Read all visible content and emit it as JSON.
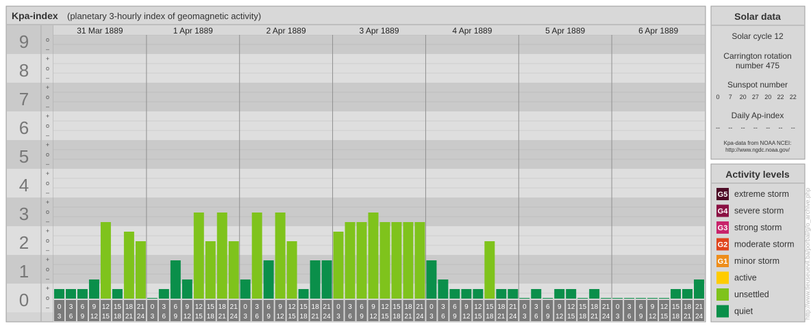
{
  "header": {
    "title": "Kpa-index",
    "subtitle": "(planetary 3-hourly index of geomagnetic activity)"
  },
  "chart_data": {
    "type": "bar",
    "ylim": [
      0,
      9
    ],
    "y_major_labels": [
      "0",
      "1",
      "2",
      "3",
      "4",
      "5",
      "6",
      "7",
      "8",
      "9"
    ],
    "minor_marks": [
      "–",
      "o",
      "+"
    ],
    "days": [
      "31 Mar 1889",
      "1 Apr 1889",
      "2 Apr 1889",
      "3 Apr 1889",
      "4 Apr 1889",
      "5 Apr 1889",
      "6 Apr 1889"
    ],
    "hour_labels_top": [
      "0",
      "3",
      "6",
      "9",
      "12",
      "15",
      "18",
      "21"
    ],
    "hour_labels_bottom": [
      "3",
      "6",
      "9",
      "12",
      "15",
      "18",
      "21",
      "24"
    ],
    "values": [
      [
        0.333,
        0.333,
        0.333,
        0.667,
        2.667,
        0.333,
        2.333,
        2.0
      ],
      [
        0.0,
        0.333,
        1.333,
        0.667,
        3.0,
        2.0,
        3.0,
        2.0
      ],
      [
        0.667,
        3.0,
        1.333,
        3.0,
        2.0,
        0.333,
        1.333,
        1.333
      ],
      [
        2.333,
        2.667,
        2.667,
        3.0,
        2.667,
        2.667,
        2.667,
        2.667
      ],
      [
        1.333,
        0.667,
        0.333,
        0.333,
        0.333,
        2.0,
        0.333,
        0.333
      ],
      [
        0.0,
        0.333,
        0.0,
        0.333,
        0.333,
        0.0,
        0.333,
        0.0
      ],
      [
        0.0,
        0.0,
        0.0,
        0.0,
        0.0,
        0.333,
        0.333,
        0.667
      ]
    ],
    "colors": {
      "quiet": "#0a8f4a",
      "unsettled": "#7fc31c"
    }
  },
  "solar": {
    "title": "Solar data",
    "cycle": "Solar cycle 12",
    "carrington_line1": "Carrington rotation",
    "carrington_line2": "number 475",
    "sunspot_label": "Sunspot number",
    "sunspot_values": [
      "0",
      "7",
      "20",
      "27",
      "20",
      "22",
      "22"
    ],
    "ap_label": "Daily Ap-index",
    "ap_values": [
      "--",
      "--",
      "--",
      "--",
      "--",
      "--",
      "--"
    ],
    "source_line1": "Kpa-data from NOAA NCEI:",
    "source_line2": "http://www.ngdc.noaa.gov/"
  },
  "activity": {
    "title": "Activity levels",
    "items": [
      {
        "badge": "G5",
        "label": "extreme storm",
        "color": "#4d0b26"
      },
      {
        "badge": "G4",
        "label": "severe storm",
        "color": "#8a1043"
      },
      {
        "badge": "G3",
        "label": "strong storm",
        "color": "#c8236b"
      },
      {
        "badge": "G2",
        "label": "moderate storm",
        "color": "#e0441c"
      },
      {
        "badge": "G1",
        "label": "minor storm",
        "color": "#ee8d1a"
      },
      {
        "badge": "",
        "label": "active",
        "color": "#ffcc00"
      },
      {
        "badge": "",
        "label": "unsettled",
        "color": "#7fc31c"
      },
      {
        "badge": "",
        "label": "quiet",
        "color": "#0a8f4a"
      }
    ]
  },
  "watermark": "http://www.tieuseuevil.ba/porbal/g/o_archive.php"
}
